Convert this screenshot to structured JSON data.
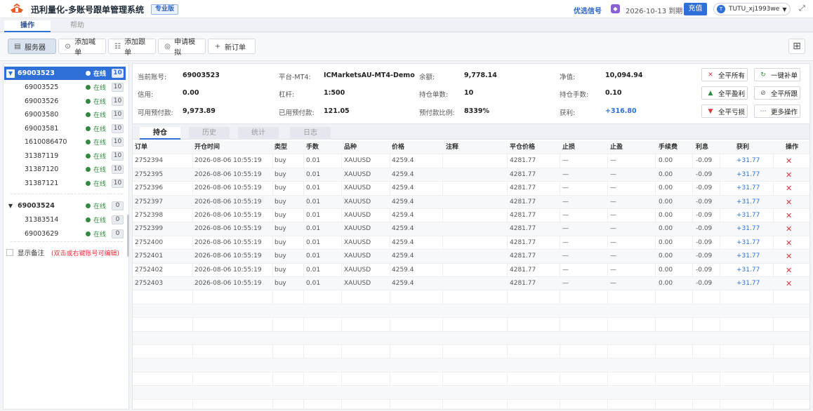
{
  "app": {
    "title": "迅利量化-多账号跟单管理系统",
    "edition": "专业版",
    "signal_link": "优选信号",
    "expire": "2026-10-13 到期",
    "recharge": "充值",
    "user": "TUTU_xj1993we",
    "avatar_letter": "T"
  },
  "top_tabs": [
    "操作",
    "帮助"
  ],
  "toolbar": {
    "server": "服务器",
    "add_caller": "添加喊单",
    "add_follower": "添加跟单",
    "apply_sim": "申请模拟",
    "new_order": "新订单"
  },
  "sidebar": {
    "group1": {
      "master": {
        "id": "69003523",
        "status": "在线",
        "count": "10"
      },
      "followers": [
        {
          "id": "69003525",
          "status": "在线",
          "count": "10"
        },
        {
          "id": "69003526",
          "status": "在线",
          "count": "10"
        },
        {
          "id": "69003580",
          "status": "在线",
          "count": "10"
        },
        {
          "id": "69003581",
          "status": "在线",
          "count": "10"
        },
        {
          "id": "1610086470",
          "status": "在线",
          "count": "10"
        },
        {
          "id": "31387119",
          "status": "在线",
          "count": "10"
        },
        {
          "id": "31387120",
          "status": "在线",
          "count": "10"
        },
        {
          "id": "31387121",
          "status": "在线",
          "count": "10"
        }
      ]
    },
    "group2": {
      "master": {
        "id": "69003524",
        "status": "在线",
        "count": "0"
      },
      "followers": [
        {
          "id": "31383514",
          "status": "在线",
          "count": "0"
        },
        {
          "id": "69003629",
          "status": "在线",
          "count": "0"
        }
      ]
    },
    "show_remark": "显示备注",
    "remark_hint": "(双击或右键账号可编辑)"
  },
  "info": {
    "current_account_label": "当前账号:",
    "current_account": "69003523",
    "platform_label": "平台-MT4:",
    "platform": "ICMarketsAU-MT4-Demo",
    "balance_label": "余额:",
    "balance": "9,778.14",
    "equity_label": "净值:",
    "equity": "10,094.94",
    "credit_label": "信用:",
    "credit": "0.00",
    "leverage_label": "杠杆:",
    "leverage": "1:500",
    "positions_label": "持仓单数:",
    "positions": "10",
    "lots_label": "持仓手数:",
    "lots": "0.10",
    "free_margin_label": "可用预付款:",
    "free_margin": "9,973.89",
    "used_margin_label": "已用预付款:",
    "used_margin": "121.05",
    "margin_ratio_label": "预付款比例:",
    "margin_ratio": "8339%",
    "profit_label": "获利:",
    "profit": "+316.80"
  },
  "actions": {
    "close_all": "全平所有",
    "one_key_fill": "一键补单",
    "close_profit": "全平盈利",
    "close_follow": "全平所跟",
    "close_loss": "全平亏损",
    "more": "更多操作"
  },
  "sub_tabs": [
    "持仓",
    "历史",
    "统计",
    "日志"
  ],
  "table": {
    "headers": [
      "订单",
      "开仓时间",
      "类型",
      "手数",
      "品种",
      "价格",
      "注释",
      "平仓价格",
      "止损",
      "止盈",
      "手续费",
      "利息",
      "获利",
      "操作"
    ],
    "rows": [
      [
        "2752394",
        "2026-08-06 10:55:19",
        "buy",
        "0.01",
        "XAUUSD",
        "4259.4",
        "",
        "4281.77",
        "—",
        "—",
        "0.00",
        "-0.09",
        "+31.77",
        "✕"
      ],
      [
        "2752395",
        "2026-08-06 10:55:19",
        "buy",
        "0.01",
        "XAUUSD",
        "4259.4",
        "",
        "4281.77",
        "—",
        "—",
        "0.00",
        "-0.09",
        "+31.77",
        "✕"
      ],
      [
        "2752396",
        "2026-08-06 10:55:19",
        "buy",
        "0.01",
        "XAUUSD",
        "4259.4",
        "",
        "4281.77",
        "—",
        "—",
        "0.00",
        "-0.09",
        "+31.77",
        "✕"
      ],
      [
        "2752397",
        "2026-08-06 10:55:19",
        "buy",
        "0.01",
        "XAUUSD",
        "4259.4",
        "",
        "4281.77",
        "—",
        "—",
        "0.00",
        "-0.09",
        "+31.77",
        "✕"
      ],
      [
        "2752398",
        "2026-08-06 10:55:19",
        "buy",
        "0.01",
        "XAUUSD",
        "4259.4",
        "",
        "4281.77",
        "—",
        "—",
        "0.00",
        "-0.09",
        "+31.77",
        "✕"
      ],
      [
        "2752399",
        "2026-08-06 10:55:19",
        "buy",
        "0.01",
        "XAUUSD",
        "4259.4",
        "",
        "4281.77",
        "—",
        "—",
        "0.00",
        "-0.09",
        "+31.77",
        "✕"
      ],
      [
        "2752400",
        "2026-08-06 10:55:19",
        "buy",
        "0.01",
        "XAUUSD",
        "4259.4",
        "",
        "4281.77",
        "—",
        "—",
        "0.00",
        "-0.09",
        "+31.77",
        "✕"
      ],
      [
        "2752401",
        "2026-08-06 10:55:19",
        "buy",
        "0.01",
        "XAUUSD",
        "4259.4",
        "",
        "4281.77",
        "—",
        "—",
        "0.00",
        "-0.09",
        "+31.77",
        "✕"
      ],
      [
        "2752402",
        "2026-08-06 10:55:19",
        "buy",
        "0.01",
        "XAUUSD",
        "4259.4",
        "",
        "4281.77",
        "—",
        "—",
        "0.00",
        "-0.09",
        "+31.77",
        "✕"
      ],
      [
        "2752403",
        "2026-08-06 10:55:19",
        "buy",
        "0.01",
        "XAUUSD",
        "4259.4",
        "",
        "4281.77",
        "—",
        "—",
        "0.00",
        "-0.09",
        "+31.77",
        "✕"
      ]
    ]
  },
  "colors": {
    "accent": "#2f6fd8",
    "online": "#2f8a3e",
    "danger": "#d9363e"
  }
}
